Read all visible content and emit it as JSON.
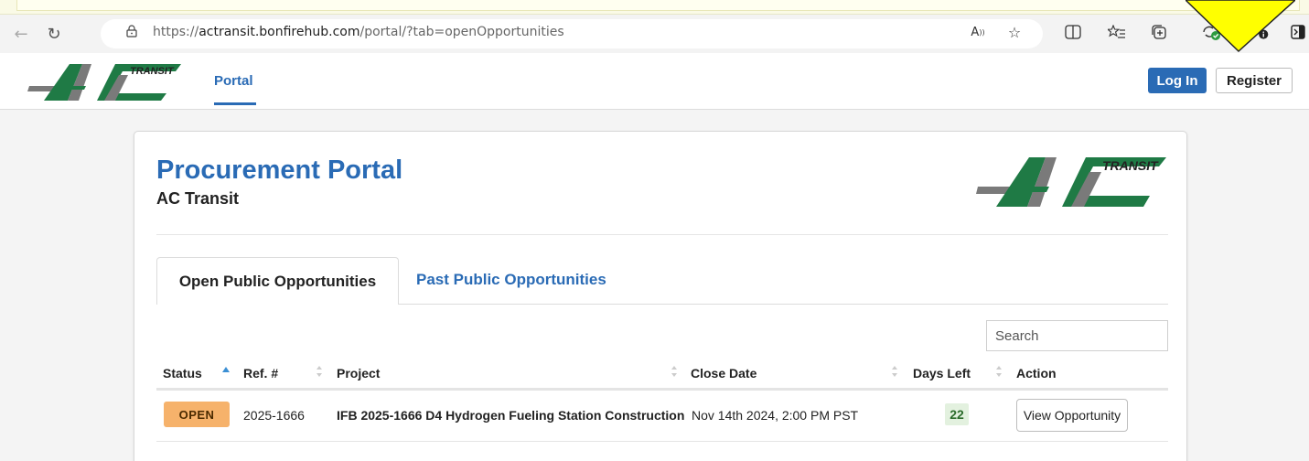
{
  "browser": {
    "url_scheme": "https://",
    "url_host": "actransit.bonfirehub.com",
    "url_path": "/portal/?tab=openOpportunities"
  },
  "header": {
    "logo_text": "TRANSIT",
    "nav_portal_label": "Portal",
    "login_label": "Log In",
    "register_label": "Register"
  },
  "main": {
    "title": "Procurement Portal",
    "subtitle": "AC Transit",
    "logo_text": "TRANSIT",
    "tabs": [
      {
        "label": "Open Public Opportunities",
        "active": true
      },
      {
        "label": "Past Public Opportunities",
        "active": false
      }
    ],
    "search": {
      "placeholder": "Search",
      "value": ""
    },
    "table": {
      "columns": [
        "Status",
        "Ref. #",
        "Project",
        "Close Date",
        "Days Left",
        "Action"
      ],
      "rows": [
        {
          "status": "OPEN",
          "ref": "2025-1666",
          "project": "IFB 2025-1666 D4 Hydrogen Fueling Station Construction",
          "close_date": "Nov 14th 2024, 2:00 PM PST",
          "days_left": "22",
          "action": "View Opportunity"
        }
      ]
    }
  },
  "colors": {
    "brand_blue": "#2a6bb5",
    "logo_green": "#1f7a45",
    "logo_gray": "#7a7a7a",
    "status_open": "#f6b26b",
    "days_left_bg": "#e3f1df",
    "annotation_yellow": "#ffff00"
  },
  "icons": [
    "back-arrow-icon",
    "reload-icon",
    "lock-icon",
    "read-aloud-icon",
    "favorite-star-icon",
    "split-screen-icon",
    "favorites-icon",
    "collections-icon",
    "extension-icon",
    "more-icon",
    "sidebar-icon",
    "sort-icon"
  ]
}
